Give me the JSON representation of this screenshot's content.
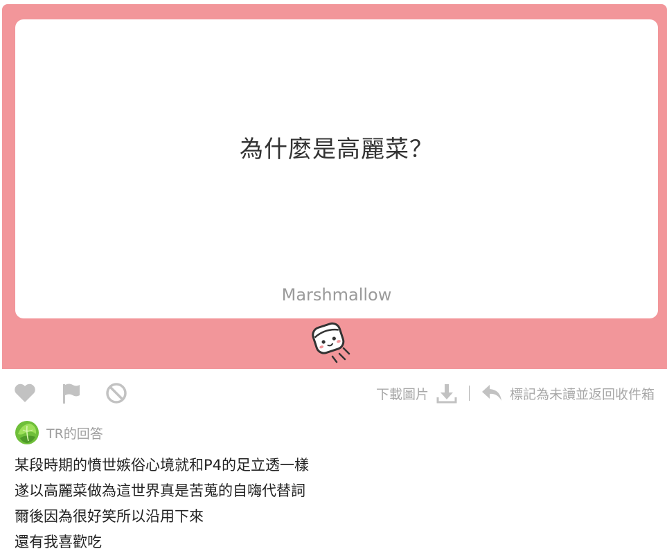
{
  "card": {
    "question": "為什麼是高麗菜？",
    "brand": "Marshmallow"
  },
  "colors": {
    "panel": "#f2969a",
    "icon_gray": "#c2c2c2",
    "text_gray": "#a8a8a8"
  },
  "actions": {
    "like_icon": "heart-icon",
    "flag_icon": "flag-icon",
    "block_icon": "block-icon",
    "download_label": "下載圖片",
    "mark_unread_label": "標記為未讀並返回收件箱"
  },
  "answer": {
    "label": "TR的回答",
    "lines": [
      "某段時期的憤世嫉俗心境就和P4的足立透一樣",
      "遂以高麗菜做為這世界真是苦蒐的自嗨代替詞",
      "爾後因為很好笑所以沿用下來",
      "還有我喜歡吃"
    ]
  }
}
